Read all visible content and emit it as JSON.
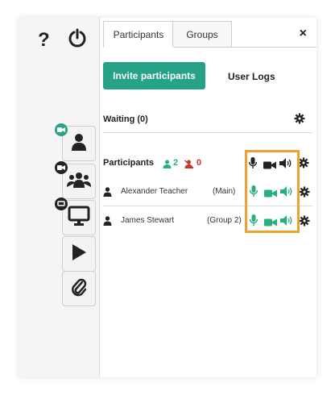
{
  "tabs": [
    {
      "label": "Participants"
    },
    {
      "label": "Groups"
    }
  ],
  "close_label": "×",
  "invite_label": "Invite participants",
  "user_logs_label": "User Logs",
  "waiting_label": "Waiting (0)",
  "participants_label": "Participants",
  "participant_count": "2",
  "muted_count": "0",
  "rows": [
    {
      "name": "Alexander Teacher",
      "group": "(Main)"
    },
    {
      "name": "James Stewart",
      "group": "(Group 2)"
    }
  ],
  "icons": {
    "help": "?",
    "power": "power-icon",
    "camera": "camera-icon",
    "user": "user-icon",
    "users": "users-icon",
    "monitor": "monitor-icon",
    "play": "play-icon",
    "paperclip": "paperclip-icon",
    "gear": "gear-icon",
    "mic": "microphone-icon",
    "video": "video-camera-icon",
    "speaker": "speaker-icon"
  },
  "colors": {
    "accent": "#26a386",
    "green": "#27b07e",
    "red": "#c0392b",
    "highlight": "#f0a030"
  }
}
